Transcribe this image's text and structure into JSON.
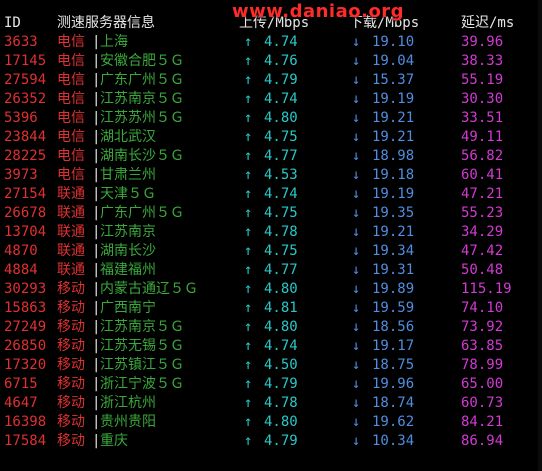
{
  "header": {
    "id": "ID",
    "server_name": "测速服务器信息",
    "upload": "上传/Mbps",
    "download": "下载/Mbps",
    "latency": "延迟/ms"
  },
  "watermark": "www.daniao.org",
  "separator": "|",
  "up_arrow": "↑",
  "down_arrow": "↓",
  "colors": {
    "background": "#000000",
    "header": "#e6e6e6",
    "id": "#e03030",
    "isp": "#e03030",
    "location": "#3aa83a",
    "upload": "#28c8c8",
    "download": "#4f8ee0",
    "latency": "#d23ad2",
    "watermark": "#ff2a2a"
  },
  "rows": [
    {
      "id": "3633",
      "isp": "电信",
      "location": "上海",
      "upload": "4.74",
      "download": "19.10",
      "latency": "39.96"
    },
    {
      "id": "17145",
      "isp": "电信",
      "location": "安徽合肥５Ｇ",
      "upload": "4.76",
      "download": "19.04",
      "latency": "38.33"
    },
    {
      "id": "27594",
      "isp": "电信",
      "location": "广东广州５Ｇ",
      "upload": "4.79",
      "download": "15.37",
      "latency": "55.19"
    },
    {
      "id": "26352",
      "isp": "电信",
      "location": "江苏南京５Ｇ",
      "upload": "4.74",
      "download": "19.19",
      "latency": "30.30"
    },
    {
      "id": "5396",
      "isp": "电信",
      "location": "江苏苏州５Ｇ",
      "upload": "4.80",
      "download": "19.21",
      "latency": "33.51"
    },
    {
      "id": "23844",
      "isp": "电信",
      "location": "湖北武汉",
      "upload": "4.75",
      "download": "19.21",
      "latency": "49.11"
    },
    {
      "id": "28225",
      "isp": "电信",
      "location": "湖南长沙５Ｇ",
      "upload": "4.77",
      "download": "18.98",
      "latency": "56.82"
    },
    {
      "id": "3973",
      "isp": "电信",
      "location": "甘肃兰州",
      "upload": "4.53",
      "download": "19.18",
      "latency": "60.41"
    },
    {
      "id": "27154",
      "isp": "联通",
      "location": "天津５Ｇ",
      "upload": "4.74",
      "download": "19.19",
      "latency": "47.21"
    },
    {
      "id": "26678",
      "isp": "联通",
      "location": "广东广州５Ｇ",
      "upload": "4.75",
      "download": "19.35",
      "latency": "55.23"
    },
    {
      "id": "13704",
      "isp": "联通",
      "location": "江苏南京",
      "upload": "4.78",
      "download": "19.21",
      "latency": "34.29"
    },
    {
      "id": "4870",
      "isp": "联通",
      "location": "湖南长沙",
      "upload": "4.75",
      "download": "19.34",
      "latency": "47.42"
    },
    {
      "id": "4884",
      "isp": "联通",
      "location": "福建福州",
      "upload": "4.77",
      "download": "19.31",
      "latency": "50.48"
    },
    {
      "id": "30293",
      "isp": "移动",
      "location": "内蒙古通辽５Ｇ",
      "upload": "4.80",
      "download": "19.89",
      "latency": "115.19"
    },
    {
      "id": "15863",
      "isp": "移动",
      "location": "广西南宁",
      "upload": "4.81",
      "download": "19.59",
      "latency": "74.10"
    },
    {
      "id": "27249",
      "isp": "移动",
      "location": "江苏南京５Ｇ",
      "upload": "4.80",
      "download": "18.56",
      "latency": "73.92"
    },
    {
      "id": "26850",
      "isp": "移动",
      "location": "江苏无锡５Ｇ",
      "upload": "4.74",
      "download": "19.17",
      "latency": "63.85"
    },
    {
      "id": "17320",
      "isp": "移动",
      "location": "江苏镇江５Ｇ",
      "upload": "4.50",
      "download": "18.75",
      "latency": "78.99"
    },
    {
      "id": "6715",
      "isp": "移动",
      "location": "浙江宁波５Ｇ",
      "upload": "4.79",
      "download": "19.96",
      "latency": "65.00"
    },
    {
      "id": "4647",
      "isp": "移动",
      "location": "浙江杭州",
      "upload": "4.78",
      "download": "18.74",
      "latency": "60.73"
    },
    {
      "id": "16398",
      "isp": "移动",
      "location": "贵州贵阳",
      "upload": "4.80",
      "download": "19.62",
      "latency": "84.21"
    },
    {
      "id": "17584",
      "isp": "移动",
      "location": "重庆",
      "upload": "4.79",
      "download": "10.34",
      "latency": "86.94"
    }
  ]
}
